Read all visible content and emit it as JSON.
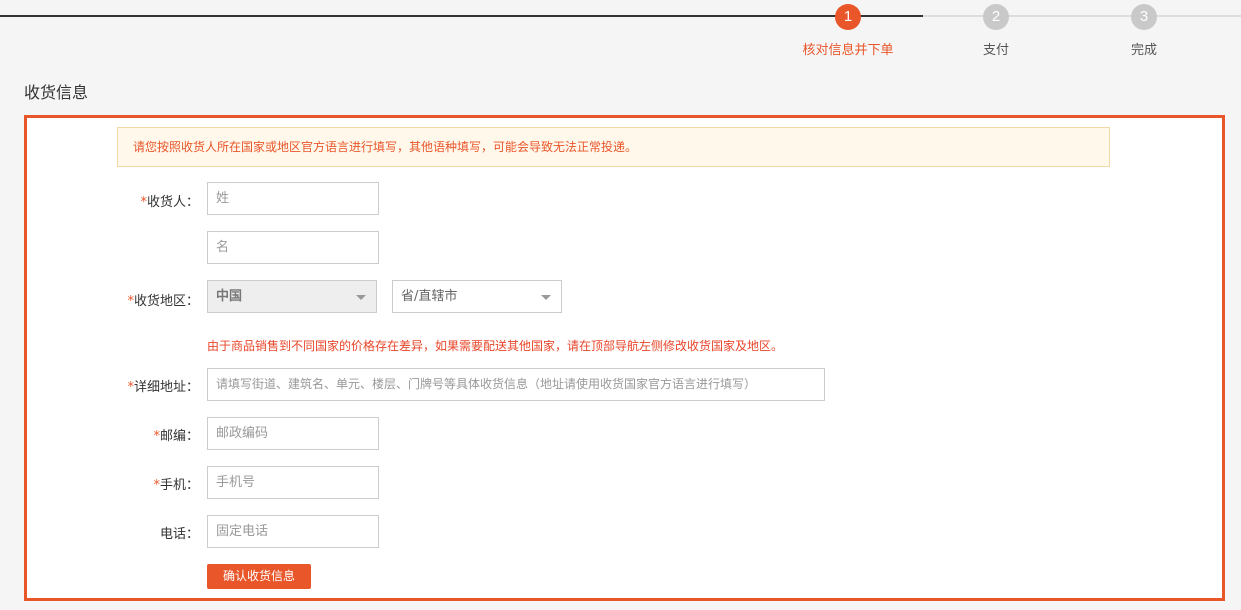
{
  "steps": [
    {
      "number": "1",
      "label": "核对信息并下单"
    },
    {
      "number": "2",
      "label": "支付"
    },
    {
      "number": "3",
      "label": "完成"
    }
  ],
  "section_title": "收货信息",
  "notice": "请您按照收货人所在国家或地区官方语言进行填写，其他语种填写，可能会导致无法正常投递。",
  "form": {
    "required_mark": "*",
    "recipient_label": "收货人：",
    "last_name_placeholder": "姓",
    "first_name_placeholder": "名",
    "region_label": "收货地区：",
    "country_value": "中国",
    "province_placeholder": "省/直辖市",
    "region_hint": "由于商品销售到不同国家的价格存在差异，如果需要配送其他国家，请在顶部导航左侧修改收货国家及地区。",
    "address_label": "详细地址：",
    "address_placeholder": "请填写街道、建筑名、单元、楼层、门牌号等具体收货信息（地址请使用收货国家官方语言进行填写）",
    "postcode_label": "邮编：",
    "postcode_placeholder": "邮政编码",
    "mobile_label": "手机：",
    "mobile_placeholder": "手机号",
    "phone_label": "电话：",
    "phone_placeholder": "固定电话",
    "confirm_button": "确认收货信息"
  },
  "colors": {
    "accent": "#e8562a",
    "notice_bg": "#fff8eb"
  }
}
